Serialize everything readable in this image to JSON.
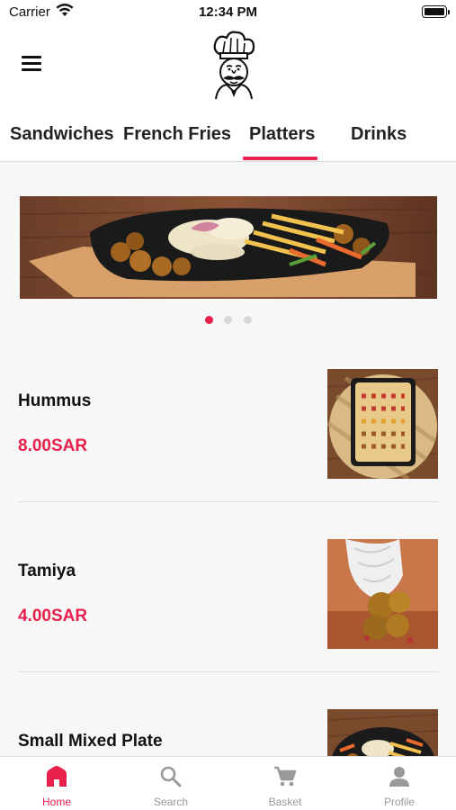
{
  "status_bar": {
    "carrier": "Carrier",
    "time": "12:34 PM"
  },
  "header": {
    "menu_icon": "hamburger-menu-icon",
    "logo": "chef-logo"
  },
  "tabs": [
    {
      "label": "Sandwiches",
      "active": false
    },
    {
      "label": "French Fries",
      "active": false
    },
    {
      "label": "Platters",
      "active": true
    },
    {
      "label": "Drinks",
      "active": false
    }
  ],
  "carousel": {
    "page_count": 3,
    "active_index": 0
  },
  "items": [
    {
      "name": "Hummus",
      "price": "8.00SAR"
    },
    {
      "name": "Tamiya",
      "price": "4.00SAR"
    },
    {
      "name": "Small Mixed Plate",
      "price": ""
    }
  ],
  "bottom_nav": [
    {
      "label": "Home",
      "icon": "home-icon",
      "active": true
    },
    {
      "label": "Search",
      "icon": "search-icon",
      "active": false
    },
    {
      "label": "Basket",
      "icon": "cart-icon",
      "active": false
    },
    {
      "label": "Profile",
      "icon": "profile-icon",
      "active": false
    }
  ],
  "colors": {
    "accent": "#e8204b",
    "inactive": "#999999"
  }
}
